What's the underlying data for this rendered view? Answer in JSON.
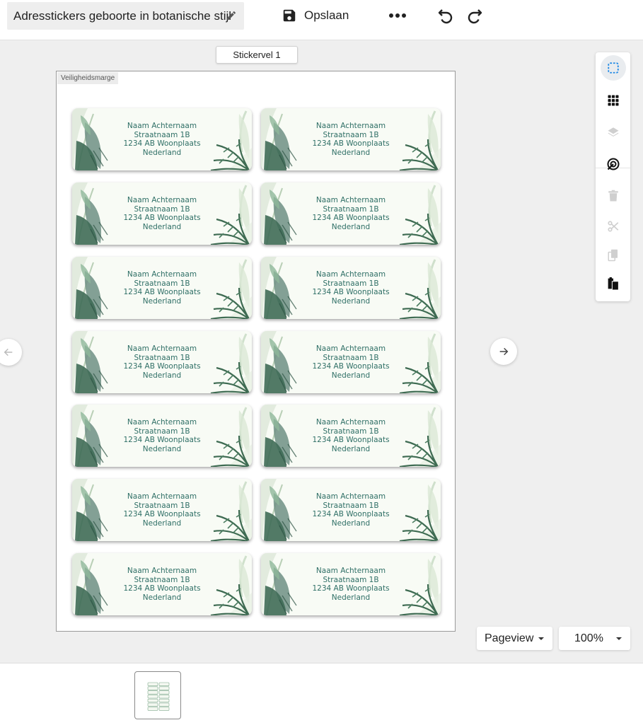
{
  "header": {
    "title": "Adresstickers geboorte in botanische stijl",
    "save_label": "Opslaan"
  },
  "sheet_tab": "Stickervel 1",
  "page": {
    "margin_label": "Veiligheidsmarge"
  },
  "stickers": [
    {
      "name": "Naam Achternaam",
      "street": "Straatnaam 1B",
      "city": "1234 AB Woonplaats",
      "country": "Nederland"
    },
    {
      "name": "Naam Achternaam",
      "street": "Straatnaam 1B",
      "city": "1234 AB Woonplaats",
      "country": "Nederland"
    },
    {
      "name": "Naam Achternaam",
      "street": "Straatnaam 1B",
      "city": "1234 AB Woonplaats",
      "country": "Nederland"
    },
    {
      "name": "Naam Achternaam",
      "street": "Straatnaam 1B",
      "city": "1234 AB Woonplaats",
      "country": "Nederland"
    },
    {
      "name": "Naam Achternaam",
      "street": "Straatnaam 1B",
      "city": "1234 AB Woonplaats",
      "country": "Nederland"
    },
    {
      "name": "Naam Achternaam",
      "street": "Straatnaam 1B",
      "city": "1234 AB Woonplaats",
      "country": "Nederland"
    },
    {
      "name": "Naam Achternaam",
      "street": "Straatnaam 1B",
      "city": "1234 AB Woonplaats",
      "country": "Nederland"
    },
    {
      "name": "Naam Achternaam",
      "street": "Straatnaam 1B",
      "city": "1234 AB Woonplaats",
      "country": "Nederland"
    },
    {
      "name": "Naam Achternaam",
      "street": "Straatnaam 1B",
      "city": "1234 AB Woonplaats",
      "country": "Nederland"
    },
    {
      "name": "Naam Achternaam",
      "street": "Straatnaam 1B",
      "city": "1234 AB Woonplaats",
      "country": "Nederland"
    },
    {
      "name": "Naam Achternaam",
      "street": "Straatnaam 1B",
      "city": "1234 AB Woonplaats",
      "country": "Nederland"
    },
    {
      "name": "Naam Achternaam",
      "street": "Straatnaam 1B",
      "city": "1234 AB Woonplaats",
      "country": "Nederland"
    },
    {
      "name": "Naam Achternaam",
      "street": "Straatnaam 1B",
      "city": "1234 AB Woonplaats",
      "country": "Nederland"
    },
    {
      "name": "Naam Achternaam",
      "street": "Straatnaam 1B",
      "city": "1234 AB Woonplaats",
      "country": "Nederland"
    }
  ],
  "toolbar": {
    "tools": [
      "select-icon",
      "grid-icon",
      "layers-icon",
      "target-icon",
      "trash-icon",
      "scissors-icon",
      "copy-icon",
      "paste-icon"
    ]
  },
  "view": {
    "mode_label": "Pageview",
    "zoom_label": "100%"
  },
  "colors": {
    "accent": "#1e88e5",
    "address_text": "#2f6f66",
    "leaf_dark": "#3f6b57",
    "leaf_light": "#8fb89a"
  }
}
